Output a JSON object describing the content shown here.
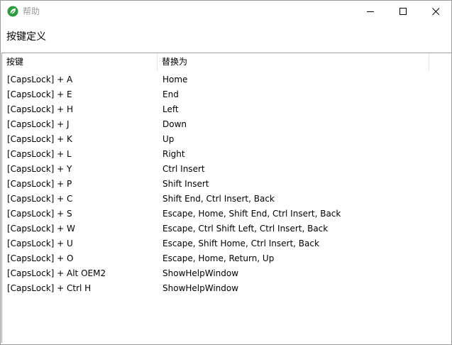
{
  "window": {
    "title": "帮助"
  },
  "heading": "按键定义",
  "table": {
    "columns": [
      "按键",
      "替换为"
    ],
    "rows": [
      {
        "key": "[CapsLock] + A",
        "replacement": "Home"
      },
      {
        "key": "[CapsLock] + E",
        "replacement": "End"
      },
      {
        "key": "[CapsLock] + H",
        "replacement": "Left"
      },
      {
        "key": "[CapsLock] + J",
        "replacement": "Down"
      },
      {
        "key": "[CapsLock] + K",
        "replacement": "Up"
      },
      {
        "key": "[CapsLock] + L",
        "replacement": "Right"
      },
      {
        "key": "[CapsLock] + Y",
        "replacement": "Ctrl Insert"
      },
      {
        "key": "[CapsLock] + P",
        "replacement": "Shift Insert"
      },
      {
        "key": "[CapsLock] + C",
        "replacement": "Shift End, Ctrl Insert, Back"
      },
      {
        "key": "[CapsLock] + S",
        "replacement": "Escape, Home, Shift End, Ctrl Insert, Back"
      },
      {
        "key": "[CapsLock] + W",
        "replacement": "Escape, Ctrl Shift Left, Ctrl Insert, Back"
      },
      {
        "key": "[CapsLock] + U",
        "replacement": "Escape, Shift Home, Ctrl Insert, Back"
      },
      {
        "key": "[CapsLock] + O",
        "replacement": "Escape, Home, Return, Up"
      },
      {
        "key": "[CapsLock] + Alt OEM2",
        "replacement": "ShowHelpWindow"
      },
      {
        "key": "[CapsLock] + Ctrl H",
        "replacement": "ShowHelpWindow"
      }
    ]
  },
  "icons": {
    "app": "leaf-icon",
    "minimize": "minimize-icon",
    "maximize": "maximize-icon",
    "close": "close-icon"
  },
  "colors": {
    "app_icon": "#2e9a3e",
    "title_text": "#9a9a9a",
    "border": "#a0a0a0"
  }
}
